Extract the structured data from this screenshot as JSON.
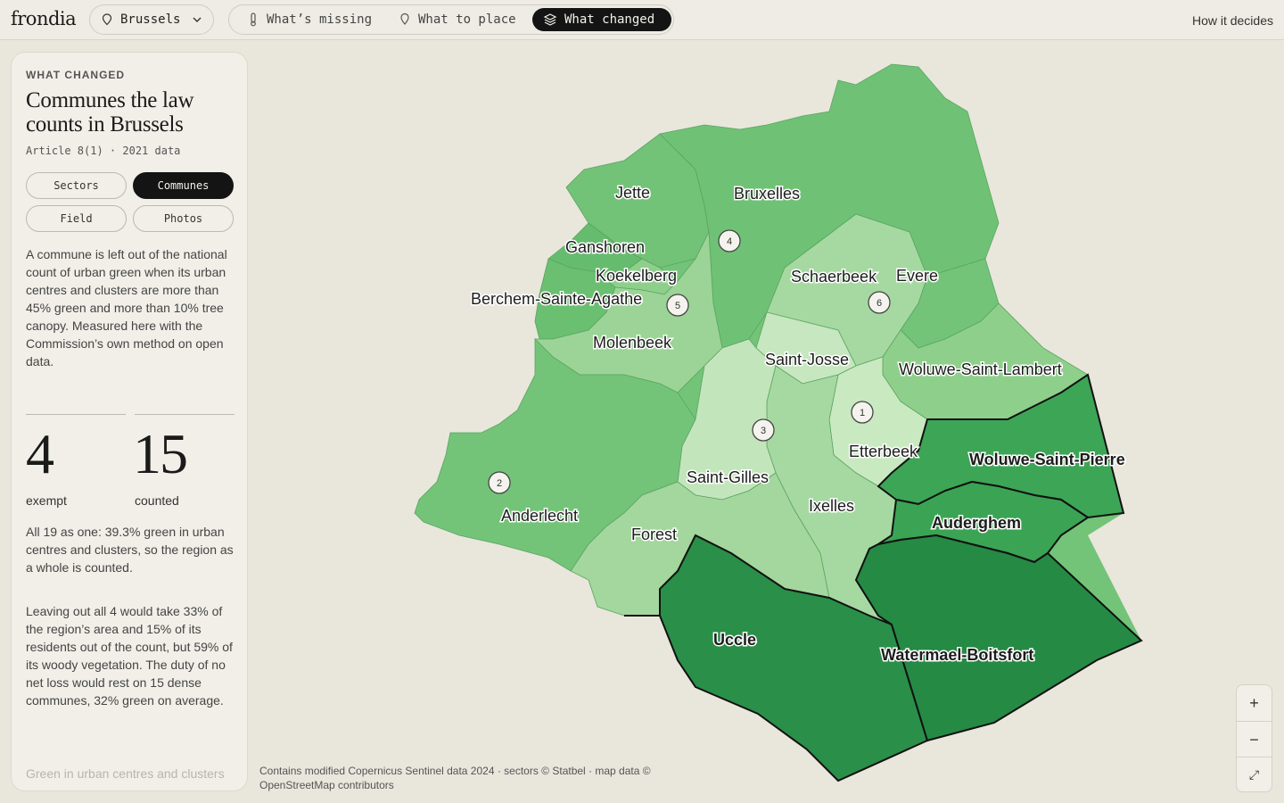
{
  "app": {
    "logo": "frondia",
    "how_link": "How it decides"
  },
  "city_select": {
    "value": "Brussels"
  },
  "tabs": [
    {
      "label": "What’s missing",
      "icon": "thermometer-icon",
      "active": false
    },
    {
      "label": "What to place",
      "icon": "pin-icon",
      "active": false
    },
    {
      "label": "What changed",
      "icon": "layers-icon",
      "active": true
    }
  ],
  "panel": {
    "eyebrow": "WHAT CHANGED",
    "title": "Communes the law counts in Brussels",
    "subtitle": "Article 8(1) · 2021 data",
    "pills": [
      {
        "label": "Sectors",
        "active": false
      },
      {
        "label": "Communes",
        "active": true
      },
      {
        "label": "Field",
        "active": false
      },
      {
        "label": "Photos",
        "active": false
      }
    ],
    "intro": "A commune is left out of the national count of urban green when its urban centres and clusters are more than 45% green and more than 10% tree canopy. Measured here with the Commission’s own method on open data.",
    "stats": [
      {
        "value": "4",
        "label": "exempt"
      },
      {
        "value": "15",
        "label": "counted"
      }
    ],
    "all_as_one": "All 19 as one: 39.3% green in urban centres and clusters, so the region as a whole is counted.",
    "leaving_out": "Leaving out all 4 would take 33% of the region’s area and 15% of its residents out of the count, but 59% of its woody vegetation. The duty of no net loss would rest on 15 dense communes, 32% green on average.",
    "footer_hint": "Green in urban centres and clusters"
  },
  "map": {
    "communes": [
      {
        "name": "Jette",
        "status": "counted",
        "color": "#72c277"
      },
      {
        "name": "Bruxelles",
        "status": "counted",
        "color": "#6fc275"
      },
      {
        "name": "Ganshoren",
        "status": "counted",
        "color": "#66bc6e"
      },
      {
        "name": "Koekelberg",
        "status": "counted",
        "color": "#8fcf8c"
      },
      {
        "name": "Berchem-Sainte-Agathe",
        "status": "counted",
        "color": "#6abf70"
      },
      {
        "name": "Schaerbeek",
        "status": "counted",
        "color": "#a6d9a1"
      },
      {
        "name": "Evere",
        "status": "counted",
        "color": "#73c478"
      },
      {
        "name": "Molenbeek",
        "status": "counted",
        "color": "#9bd496"
      },
      {
        "name": "Saint-Josse",
        "status": "counted",
        "color": "#c6e7bf"
      },
      {
        "name": "Woluwe-Saint-Lambert",
        "status": "counted",
        "color": "#8fcf8c"
      },
      {
        "name": "Etterbeek",
        "status": "counted",
        "color": "#c9e9c1"
      },
      {
        "name": "Saint-Gilles",
        "status": "counted",
        "color": "#c3e5bc"
      },
      {
        "name": "Ixelles",
        "status": "counted",
        "color": "#a6d9a1"
      },
      {
        "name": "Anderlecht",
        "status": "counted",
        "color": "#73c478"
      },
      {
        "name": "Forest",
        "status": "counted",
        "color": "#a3d79d"
      },
      {
        "name": "Woluwe-Saint-Pierre",
        "status": "exempt",
        "color": "#3da556"
      },
      {
        "name": "Auderghem",
        "status": "exempt",
        "color": "#3aa454"
      },
      {
        "name": "Uccle",
        "status": "exempt",
        "color": "#2a8f48"
      },
      {
        "name": "Watermael-Boitsfort",
        "status": "exempt",
        "color": "#258a44"
      }
    ],
    "markers": [
      "1",
      "2",
      "3",
      "4",
      "5",
      "6"
    ],
    "attribution": "Contains modified Copernicus Sentinel data 2024 · sectors © Statbel · map data © OpenStreetMap contributors",
    "zoom": {
      "in": "+",
      "out": "−",
      "fullscreen": "⤢"
    }
  }
}
